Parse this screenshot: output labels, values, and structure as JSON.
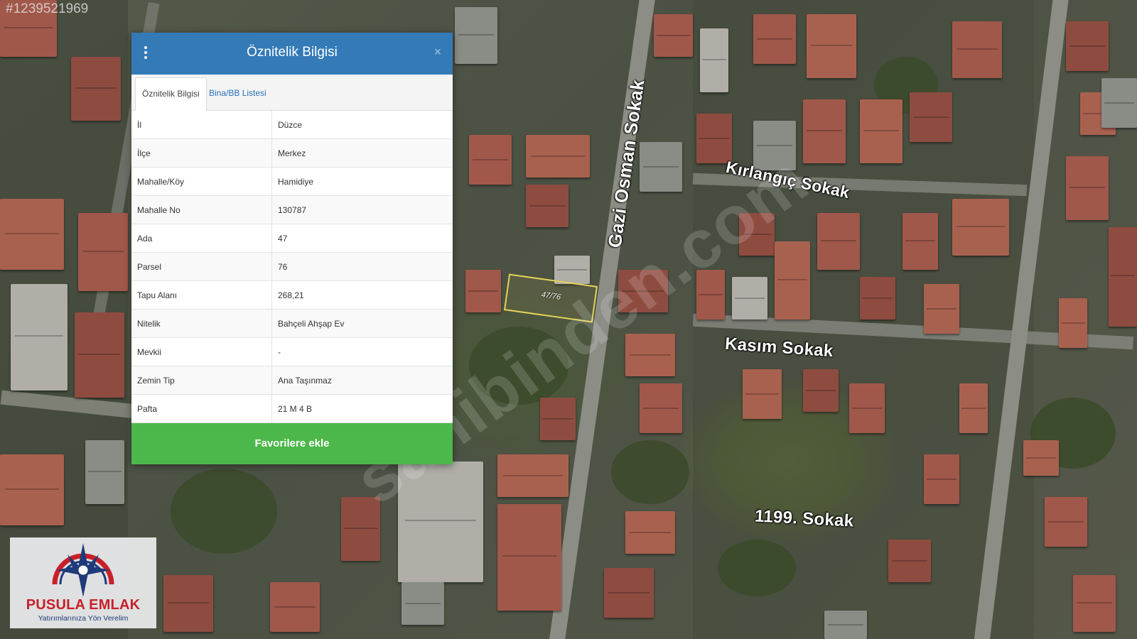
{
  "ad_id": "#1239521969",
  "map": {
    "streets": [
      "Gazi Osman Sokak",
      "Kırlangıç Sokak",
      "Kasım Sokak",
      "1199. Sokak"
    ],
    "parcel_label": "47/76",
    "watermark": "sahibinden.com"
  },
  "dialog": {
    "title": "Öznitelik Bilgisi",
    "menu_icon": "kebab-menu-icon",
    "close_icon": "close-icon",
    "close_glyph": "×",
    "tabs": [
      "Öznitelik Bilgisi",
      "Bina/BB Listesi"
    ],
    "active_tab": "Öznitelik Bilgisi",
    "rows": [
      {
        "key": "İl",
        "value": "Düzce"
      },
      {
        "key": "İlçe",
        "value": "Merkez"
      },
      {
        "key": "Mahalle/Köy",
        "value": "Hamidiye"
      },
      {
        "key": "Mahalle No",
        "value": "130787"
      },
      {
        "key": "Ada",
        "value": "47"
      },
      {
        "key": "Parsel",
        "value": "76"
      },
      {
        "key": "Tapu Alanı",
        "value": "268,21"
      },
      {
        "key": "Nitelik",
        "value": "Bahçeli Ahşap Ev"
      },
      {
        "key": "Mevkii",
        "value": "-"
      },
      {
        "key": "Zemin Tip",
        "value": "Ana Taşınmaz"
      },
      {
        "key": "Pafta",
        "value": "21 M 4 B"
      }
    ],
    "favorite_button": "Favorilere ekle"
  },
  "logo": {
    "name": "PUSULA EMLAK",
    "slogan": "Yatırımlarınıza Yön Verelim"
  },
  "colors": {
    "header": "#337ab7",
    "button": "#4cb74a",
    "logo_red": "#c8202a",
    "logo_blue": "#1e3a78"
  }
}
